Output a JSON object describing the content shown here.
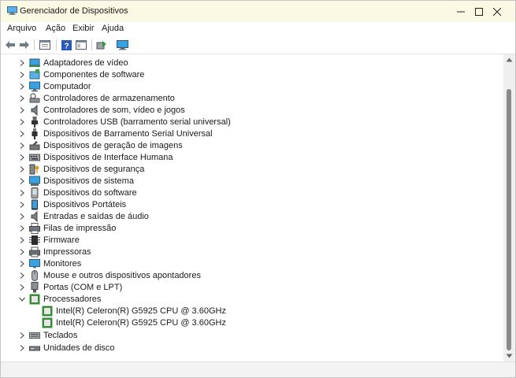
{
  "window": {
    "title": "Gerenciador de Dispositivos"
  },
  "menu": [
    "Arquivo",
    "Ação",
    "Exibir",
    "Ajuda"
  ],
  "tree": [
    {
      "label": "Adaptadores de vídeo",
      "icon": "display-adapter-icon"
    },
    {
      "label": "Componentes de software",
      "icon": "software-component-icon"
    },
    {
      "label": "Computador",
      "icon": "computer-icon"
    },
    {
      "label": "Controladores de armazenamento",
      "icon": "storage-controller-icon"
    },
    {
      "label": "Controladores de som, vídeo e jogos",
      "icon": "speaker-icon"
    },
    {
      "label": "Controladores USB (barramento serial universal)",
      "icon": "usb-icon"
    },
    {
      "label": "Dispositivos de Barramento Serial Universal",
      "icon": "usb-device-icon"
    },
    {
      "label": "Dispositivos de geração de imagens",
      "icon": "camera-icon"
    },
    {
      "label": "Dispositivos de Interface Humana",
      "icon": "hid-icon"
    },
    {
      "label": "Dispositivos de segurança",
      "icon": "security-key-icon"
    },
    {
      "label": "Dispositivos de sistema",
      "icon": "system-device-icon"
    },
    {
      "label": "Dispositivos do software",
      "icon": "software-device-icon"
    },
    {
      "label": "Dispositivos Portáteis",
      "icon": "portable-device-icon"
    },
    {
      "label": "Entradas e saídas de áudio",
      "icon": "audio-io-icon"
    },
    {
      "label": "Filas de impressão",
      "icon": "print-queue-icon"
    },
    {
      "label": "Firmware",
      "icon": "firmware-chip-icon"
    },
    {
      "label": "Impressoras",
      "icon": "printer-icon"
    },
    {
      "label": "Monitores",
      "icon": "monitor-icon"
    },
    {
      "label": "Mouse e outros dispositivos apontadores",
      "icon": "mouse-icon"
    },
    {
      "label": "Portas (COM e LPT)",
      "icon": "port-icon"
    },
    {
      "label": "Processadores",
      "icon": "processor-icon",
      "expanded": true,
      "children": [
        {
          "label": "Intel(R) Celeron(R) G5925 CPU @ 3.60GHz",
          "icon": "processor-icon"
        },
        {
          "label": "Intel(R) Celeron(R) G5925 CPU @ 3.60GHz",
          "icon": "processor-icon"
        }
      ]
    },
    {
      "label": "Teclados",
      "icon": "keyboard-icon"
    },
    {
      "label": "Unidades de disco",
      "icon": "disk-drive-icon"
    }
  ],
  "colors": {
    "titlebar": "#fafae4",
    "accent": "#1e90d8",
    "chip": "#3a8c3a"
  }
}
